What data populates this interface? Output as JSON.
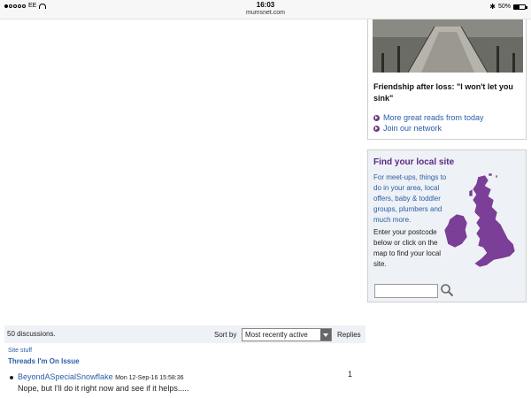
{
  "status_bar": {
    "carrier": "EE",
    "time": "16:03",
    "url": "mumsnet.com",
    "battery": "50%",
    "battery_level": 0.5
  },
  "reads_card": {
    "headline": "Friendship after loss: \"I won't let you sink\"",
    "links": [
      "More great reads from today",
      "Join our network"
    ]
  },
  "local_site": {
    "title": "Find your local site",
    "blue_text": "For meet-ups, things to do in your area, local offers, baby & toddler groups, plumbers and much more.",
    "dark_text": "Enter your postcode below or click on the map to find your local site.",
    "postcode_value": "",
    "map_color": "#7b3f98"
  },
  "discussions": {
    "count_text": "50 discussions.",
    "sort_label": "Sort by",
    "sort_selected": "Most recently active",
    "replies_label": "Replies"
  },
  "thread": {
    "category": "Site stuff",
    "title": "Threads I'm On Issue",
    "replies": "1",
    "post": {
      "author": "BeyondASpecialSnowflake",
      "date": "Mon 12-Sep-16 15:58:36",
      "text": "Nope, but I'll do it right now and see if it helps....."
    }
  }
}
